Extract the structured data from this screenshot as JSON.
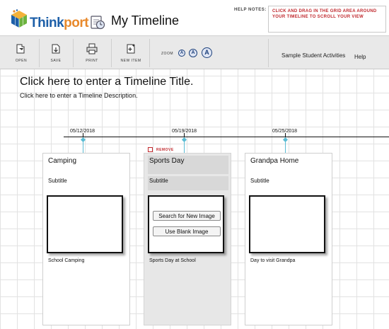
{
  "app": {
    "brand_think": "Think",
    "brand_port": "port",
    "title": "My Timeline"
  },
  "help": {
    "label": "HELP NOTES:",
    "text": "CLICK AND DRAG IN THE GRID AREA AROUND YOUR TIMELINE TO SCROLL YOUR VIEW"
  },
  "toolbar": {
    "open": "OPEN",
    "save": "SAVE",
    "print": "PRINT",
    "new_item": "NEW ITEM",
    "zoom_label": "ZOOM",
    "zoom_levels": [
      "A",
      "A",
      "A"
    ],
    "sample": "Sample Student Activities",
    "help": "Help"
  },
  "timeline": {
    "title": "Click here to enter a Timeline Title.",
    "description": "Click here to enter a Timeline Description.",
    "dates": [
      "05/12/2018",
      "05/19/2018",
      "05/25/2018"
    ]
  },
  "remove_label": "REMOVE",
  "cards": [
    {
      "title": "Camping",
      "subtitle": "Subtitle",
      "caption": "School Camping"
    },
    {
      "title": "Sports Day",
      "subtitle": "Subtitle",
      "caption": "Sports Day at School",
      "search_btn": "Search for New Image",
      "blank_btn": "Use Blank Image"
    },
    {
      "title": "Grandpa Home",
      "subtitle": "Subtitle",
      "caption": "Day to visit Grandpa"
    }
  ],
  "colors": {
    "accent_blue": "#1d5fa8",
    "accent_orange": "#e8892b",
    "help_red": "#c0282d",
    "connector": "#5bbcd4"
  }
}
